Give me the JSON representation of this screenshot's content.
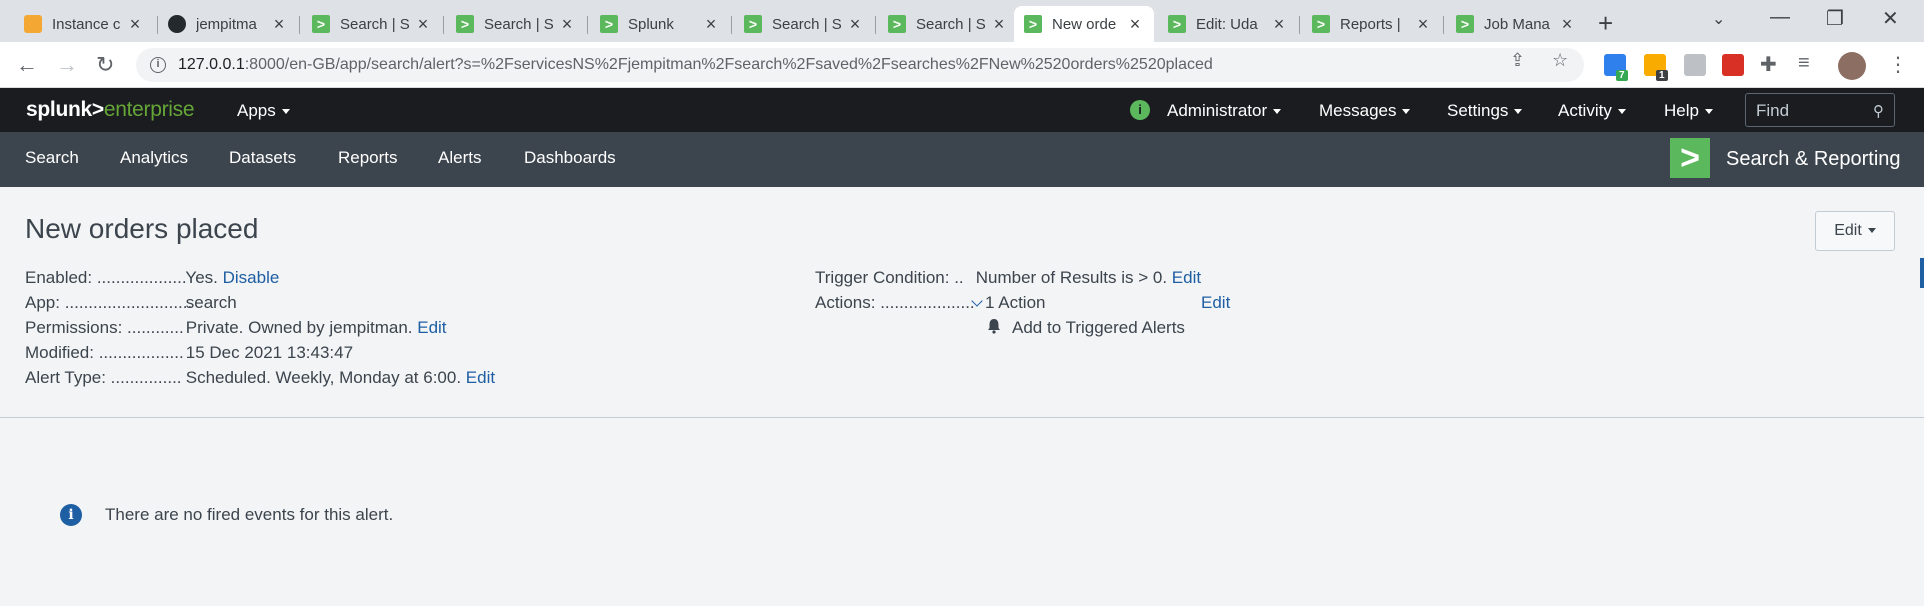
{
  "browser": {
    "tabs": [
      {
        "title": "Instance c",
        "icon": "aws-icon"
      },
      {
        "title": "jempitma",
        "icon": "github-icon"
      },
      {
        "title": "Search | S",
        "icon": "splunk-icon"
      },
      {
        "title": "Search | S",
        "icon": "splunk-icon"
      },
      {
        "title": "Splunk",
        "icon": "splunk-icon"
      },
      {
        "title": "Search | S",
        "icon": "splunk-icon"
      },
      {
        "title": "Search | S",
        "icon": "splunk-icon"
      },
      {
        "title": "New orde",
        "icon": "splunk-icon",
        "active": true
      },
      {
        "title": "Edit: Uda",
        "icon": "splunk-icon"
      },
      {
        "title": "Reports |",
        "icon": "splunk-icon"
      },
      {
        "title": "Job Mana",
        "icon": "splunk-icon"
      }
    ],
    "url_host": "127.0.0.1",
    "url_path": ":8000/en-GB/app/search/alert?s=%2FservicesNS%2Fjempitman%2Fsearch%2Fsaved%2Fsearches%2FNew%2520orders%2520placed",
    "ext_badges": [
      "7",
      "1"
    ]
  },
  "splunk": {
    "logo_main": "splunk>",
    "logo_sub": "enterprise",
    "menus": [
      "Apps",
      "Administrator",
      "Messages",
      "Settings",
      "Activity",
      "Help"
    ],
    "find_placeholder": "Find",
    "app_nav": [
      "Search",
      "Analytics",
      "Datasets",
      "Reports",
      "Alerts",
      "Dashboards"
    ],
    "app_name": "Search & Reporting",
    "accent": "#5cb85c"
  },
  "alert": {
    "title": "New orders placed",
    "edit_label": "Edit",
    "enabled_label": "Enabled: ...................",
    "enabled_value": "Yes.",
    "enabled_action": "Disable",
    "app_label": "App: ...........................",
    "app_value": "search",
    "permissions_label": "Permissions: ............",
    "permissions_value": "Private. Owned by jempitman.",
    "permissions_action": "Edit",
    "modified_label": "Modified: ..................",
    "modified_value": "15 Dec 2021 13:43:47",
    "alert_type_label": "Alert Type: ...............",
    "alert_type_value": "Scheduled. Weekly, Monday at 6:00.",
    "alert_type_action": "Edit",
    "trigger_label": "Trigger Condition: ..",
    "trigger_value": "Number of Results is > 0.",
    "trigger_action": "Edit",
    "actions_label": "Actions: ....................",
    "actions_value": "1 Action",
    "actions_edit": "Edit",
    "action_item": "Add to Triggered Alerts",
    "empty_message": "There are no fired events for this alert."
  }
}
